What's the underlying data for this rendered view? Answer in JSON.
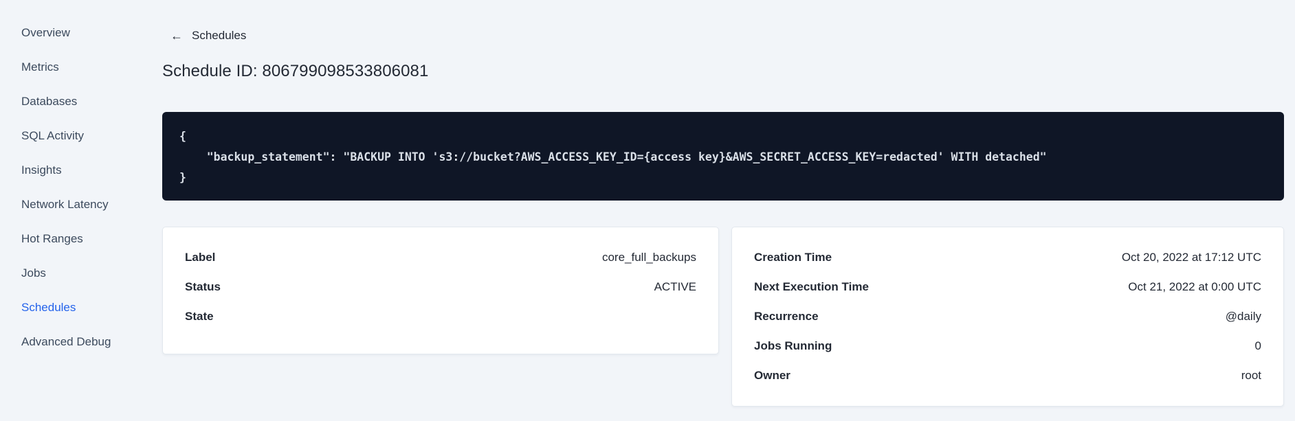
{
  "sidebar": {
    "items": [
      {
        "label": "Overview",
        "active": false
      },
      {
        "label": "Metrics",
        "active": false
      },
      {
        "label": "Databases",
        "active": false
      },
      {
        "label": "SQL Activity",
        "active": false
      },
      {
        "label": "Insights",
        "active": false
      },
      {
        "label": "Network Latency",
        "active": false
      },
      {
        "label": "Hot Ranges",
        "active": false
      },
      {
        "label": "Jobs",
        "active": false
      },
      {
        "label": "Schedules",
        "active": true
      },
      {
        "label": "Advanced Debug",
        "active": false
      }
    ]
  },
  "header": {
    "back_icon": "←",
    "back_label": "Schedules",
    "title": "Schedule ID: 806799098533806081"
  },
  "code_block": {
    "lines": [
      "{",
      "    \"backup_statement\": \"BACKUP INTO 's3://bucket?AWS_ACCESS_KEY_ID={access key}&AWS_SECRET_ACCESS_KEY=redacted' WITH detached\"",
      "}"
    ]
  },
  "left_card": {
    "rows": [
      {
        "label": "Label",
        "value": "core_full_backups"
      },
      {
        "label": "Status",
        "value": "ACTIVE"
      },
      {
        "label": "State",
        "value": ""
      }
    ]
  },
  "right_card": {
    "rows": [
      {
        "label": "Creation Time",
        "value": "Oct 20, 2022 at 17:12 UTC"
      },
      {
        "label": "Next Execution Time",
        "value": "Oct 21, 2022 at 0:00 UTC"
      },
      {
        "label": "Recurrence",
        "value": "@daily"
      },
      {
        "label": "Jobs Running",
        "value": "0"
      },
      {
        "label": "Owner",
        "value": "root"
      }
    ]
  },
  "colors": {
    "accent_blue": "#2463eb",
    "page_background": "#f2f5f9",
    "code_background": "#0f1626",
    "text_primary": "#242a35"
  }
}
